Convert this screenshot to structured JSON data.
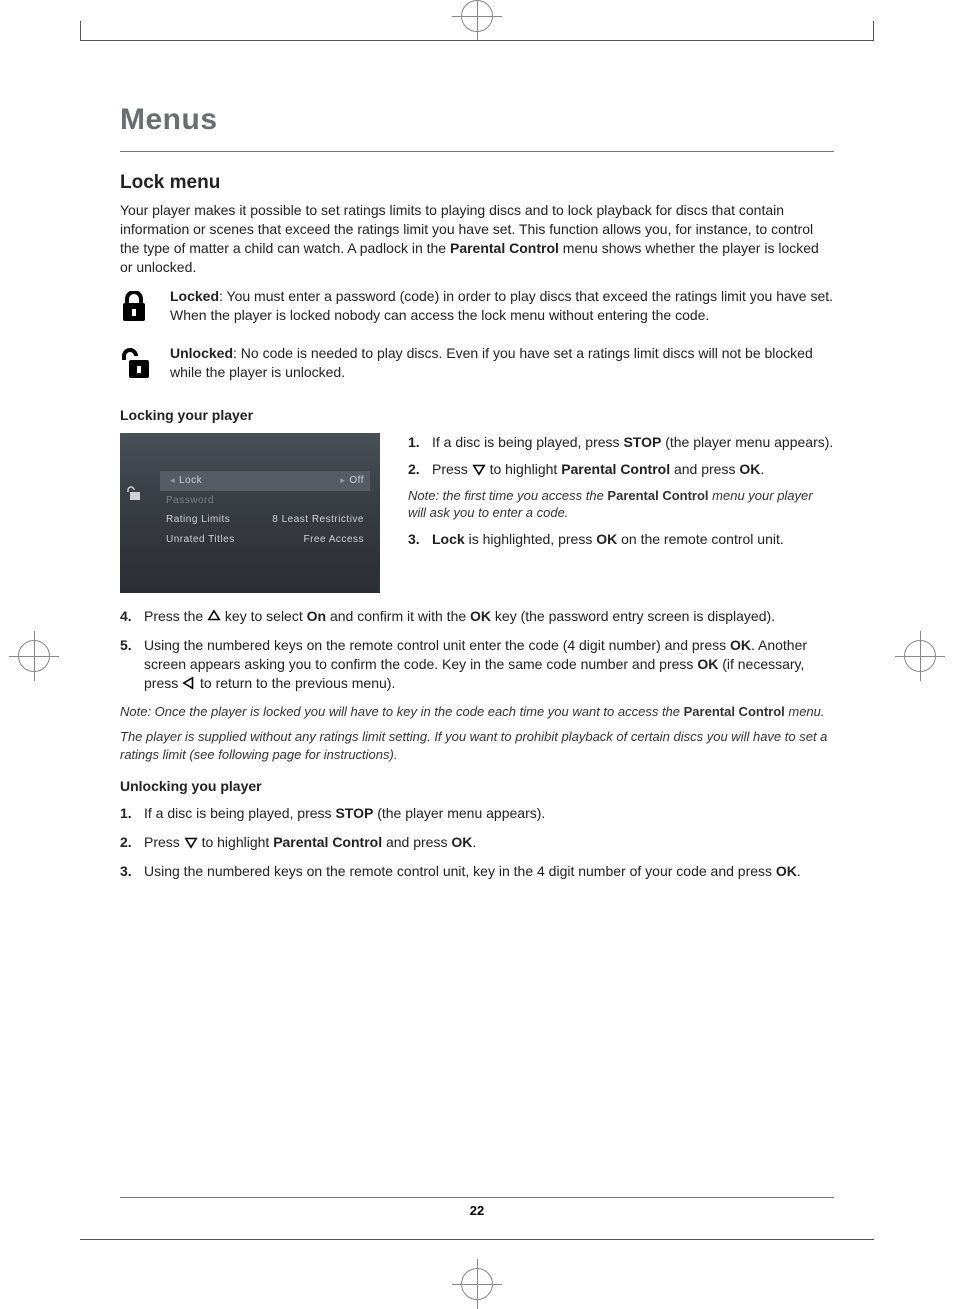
{
  "chapter": "Menus",
  "section": "Lock menu",
  "intro": "Your player makes it possible to set ratings limits to playing discs and to lock playback for discs that contain information or scenes that exceed the ratings limit you have set. This function allows you, for instance, to control the type of matter a child can watch. A padlock in the ",
  "intro_bold": "Parental Control",
  "intro_tail": " menu shows whether the player is locked or unlocked.",
  "locked": {
    "label": "Locked",
    "text": ": You must enter a password (code) in order to play discs that exceed the ratings limit you have set. When the player is locked nobody can access the lock menu without entering the code."
  },
  "unlocked": {
    "label": "Unlocked",
    "text": ": No code is needed to play discs. Even if you have set a ratings limit discs will not be blocked while the player is unlocked."
  },
  "locking_heading": "Locking your player",
  "menu_screenshot": {
    "items": [
      {
        "left": "Lock",
        "right": "Off",
        "selected": true
      },
      {
        "left": "Password",
        "right": "",
        "dim": true
      },
      {
        "left": "Rating Limits",
        "right": "8 Least Restrictive"
      },
      {
        "left": "Unrated Titles",
        "right": "Free Access"
      }
    ]
  },
  "lock_steps_right": [
    {
      "n": "1.",
      "pre": "If a disc is being played, press ",
      "b1": "STOP",
      "post": " (the player menu appears)."
    },
    {
      "n": "2.",
      "pre": "Press ",
      "icon": "down",
      "mid": " to highlight ",
      "b1": "Parental Control",
      "mid2": " and press ",
      "b2": "OK",
      "post": "."
    },
    {
      "note_pre": "Note: the first time you access the ",
      "note_b": "Parental Control",
      "note_post": " menu your player will ask you to enter a code."
    },
    {
      "n": "3.",
      "b0": "Lock",
      "mid": " is highlighted, press ",
      "b1": "OK",
      "post": " on the remote control unit."
    }
  ],
  "lock_steps_full": [
    {
      "n": "4.",
      "pre": "Press the ",
      "icon": "up",
      "mid": " key to select ",
      "b1": "On",
      "mid2": " and confirm it with the ",
      "b2": "OK",
      "post": " key (the password entry screen is displayed)."
    },
    {
      "n": "5.",
      "pre": "Using the numbered keys on the remote control unit enter the code (4 digit number) and press ",
      "b1": "OK",
      "mid": ". Another screen appears asking you to confirm the code. Key in the same code number and press ",
      "b2": "OK",
      "mid2": " (if necessary, press ",
      "icon": "left",
      "post": " to return to the previous menu)."
    }
  ],
  "lock_note1_pre": "Note: Once the player is locked you will have to key in the code each time you want to access the ",
  "lock_note1_b": "Parental Control",
  "lock_note1_post": " menu.",
  "lock_note2": "The player is supplied without any ratings limit setting. If you want to prohibit playback of certain discs you will have to set a ratings limit (see following page for instructions).",
  "unlock_heading": "Unlocking you player",
  "unlock_steps": [
    {
      "n": "1.",
      "pre": "If a disc is being played, press ",
      "b1": "STOP",
      "post": " (the player menu appears)."
    },
    {
      "n": "2.",
      "pre": "Press ",
      "icon": "down",
      "mid": " to highlight ",
      "b1": "Parental Control",
      "mid2": " and press ",
      "b2": "OK",
      "post": "."
    },
    {
      "n": "3.",
      "pre": "Using the numbered keys on the remote control unit, key in the 4 digit number of your code and press ",
      "b1": "OK",
      "post": "."
    }
  ],
  "page_number": "22"
}
